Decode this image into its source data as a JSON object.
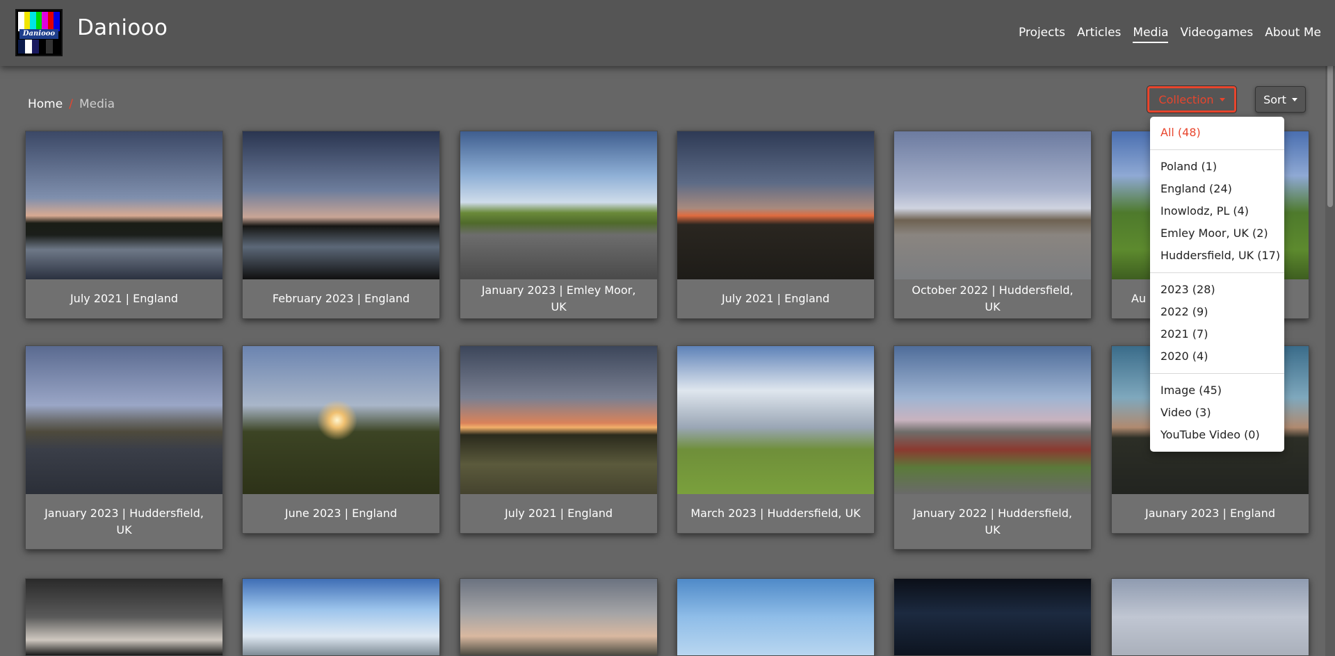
{
  "header": {
    "brand": "Daniooo",
    "logo_text": "Daniooo",
    "nav": [
      "Projects",
      "Articles",
      "Media",
      "Videogames",
      "About Me"
    ],
    "nav_active": "Media"
  },
  "breadcrumb": {
    "home": "Home",
    "separator": "/",
    "current": "Media"
  },
  "controls": {
    "collection_label": "Collection",
    "sort_label": "Sort"
  },
  "dropdown": {
    "all": "All (48)",
    "places": [
      "Poland (1)",
      "England (24)",
      "Inowlodz, PL (4)",
      "Emley Moor, UK (2)",
      "Huddersfield, UK (17)"
    ],
    "years": [
      "2023 (28)",
      "2022 (9)",
      "2021 (7)",
      "2020 (4)"
    ],
    "types": [
      "Image (45)",
      "Video (3)",
      "YouTube Video (0)"
    ]
  },
  "cards": [
    {
      "caption": "July 2021 | England"
    },
    {
      "caption": "February 2023 | England"
    },
    {
      "caption": "January 2023 | Emley Moor, UK"
    },
    {
      "caption": "July 2021 | England"
    },
    {
      "caption": "October 2022 | Huddersfield, UK"
    },
    {
      "caption": "Au"
    },
    {
      "caption": "January 2023 | Huddersfield, UK"
    },
    {
      "caption": "June 2023 | England"
    },
    {
      "caption": "July 2021 | England"
    },
    {
      "caption": "March 2023 | Huddersfield, UK"
    },
    {
      "caption": "January 2022 | Huddersfield, UK"
    },
    {
      "caption": "Jaunary 2023 | England"
    }
  ],
  "colors": {
    "accent": "#e8452d",
    "header_bg": "#555555",
    "page_bg": "#666666",
    "card_bg": "#707070"
  }
}
